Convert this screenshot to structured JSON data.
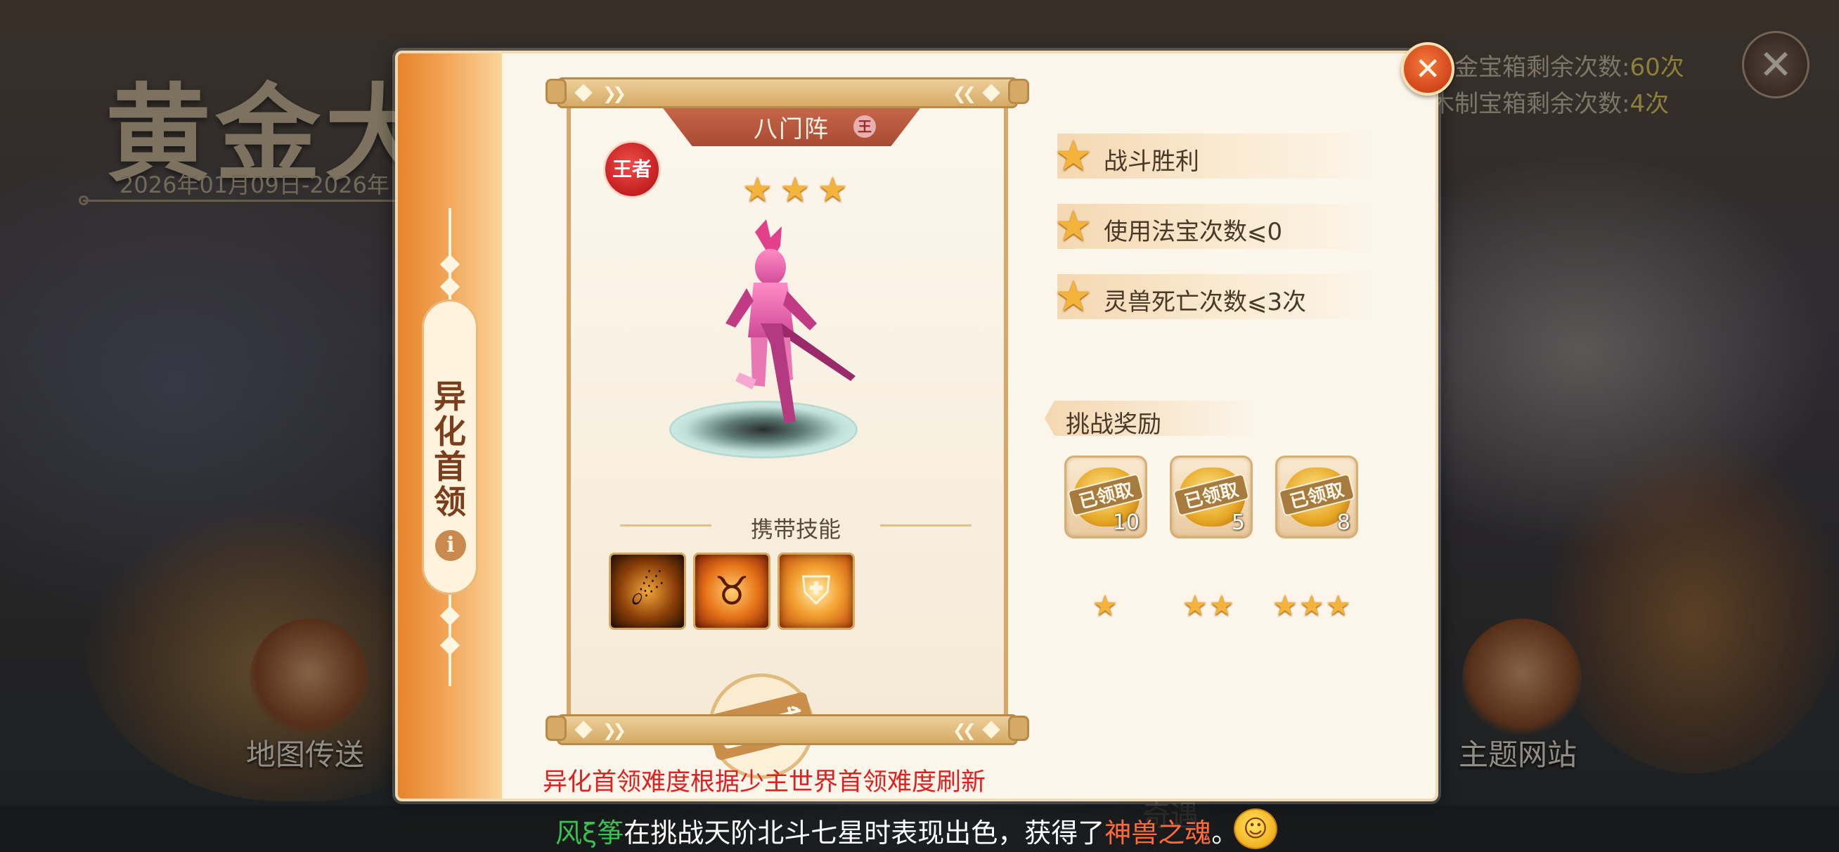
{
  "background": {
    "event_title": "黄金大",
    "event_dates": "2026年01月09日-2026年",
    "counters": {
      "gold_label": "黄金宝箱剩余次数:",
      "gold_value": "60次",
      "wood_label": "木制宝箱剩余次数:",
      "wood_value": "4次"
    },
    "nav_left_label": "地图传送",
    "nav_right_label": "主题网站",
    "hidden_label": "奇遇",
    "close_icon": "close-x-icon"
  },
  "dialog": {
    "side_tab_label": "异化首领",
    "info_icon": "i",
    "boss": {
      "name": "八门阵",
      "name_tag": "王",
      "rank": "王者",
      "stars": 3,
      "skills_label": "携带技能",
      "skills": [
        {
          "icon": "roaring-beast-skill-icon"
        },
        {
          "icon": "tiger-head-skill-icon"
        },
        {
          "icon": "golden-shield-skill-icon"
        }
      ],
      "status_stamp": "已完成"
    },
    "conditions": [
      {
        "text": "战斗胜利"
      },
      {
        "text": "使用法宝次数⩽0"
      },
      {
        "text": "灵兽死亡次数⩽3次"
      }
    ],
    "rewards_title": "挑战奖励",
    "rewards": [
      {
        "status": "已领取",
        "count": "10",
        "stars": 1
      },
      {
        "status": "已领取",
        "count": "5",
        "stars": 2
      },
      {
        "status": "已领取",
        "count": "8",
        "stars": 3
      }
    ],
    "footnote": "异化首领难度根据少主世界首领难度刷新"
  },
  "ticker": {
    "player": "风ξ筝",
    "middle": "在挑战天阶北斗七星时表现出色，获得了",
    "reward": "神兽之魂",
    "end": "。"
  },
  "colors": {
    "accent_orange": "#e7832c",
    "close_button": "#d2451c",
    "star_gold": "#f4b33a",
    "footnote_red": "#e02020",
    "ticker_name_green": "#38c050",
    "ticker_reward_red": "#ff6a3a"
  }
}
